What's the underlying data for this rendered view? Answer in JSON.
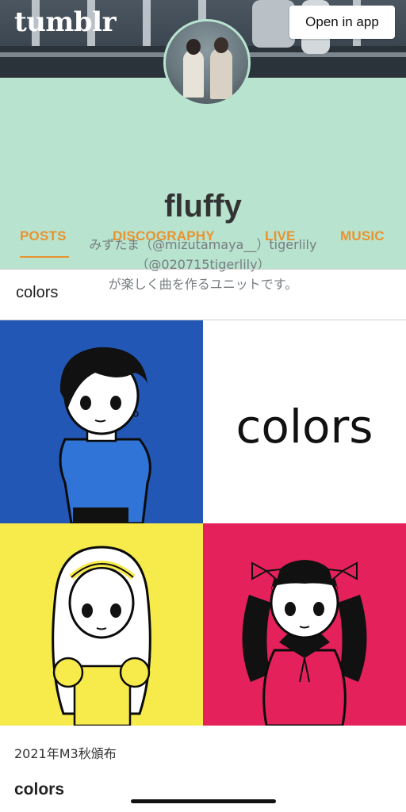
{
  "header": {
    "logo": "tumblr",
    "open_in_app": "Open in app"
  },
  "profile": {
    "name": "fluffy",
    "bio_lines": [
      "みずたま（@mizutamaya__）tigerlily",
      "（@020715tigerlily）",
      "が楽しく曲を作るユニットです。"
    ]
  },
  "tabs": [
    {
      "label": "POSTS",
      "active": true
    },
    {
      "label": "DISCOGRAPHY",
      "active": false
    },
    {
      "label": "LIVE",
      "active": false
    },
    {
      "label": "MUSIC",
      "active": false
    }
  ],
  "post": {
    "title": "colors",
    "artwork_text": "colors",
    "caption": "2021年M3秋頒布",
    "subtitle": "colors"
  },
  "colors": {
    "accent": "#e8932f",
    "profile_bg": "#b8e3cf",
    "art_blue": "#2257b5",
    "art_yellow": "#f7ea4b",
    "art_red": "#e5215b"
  }
}
